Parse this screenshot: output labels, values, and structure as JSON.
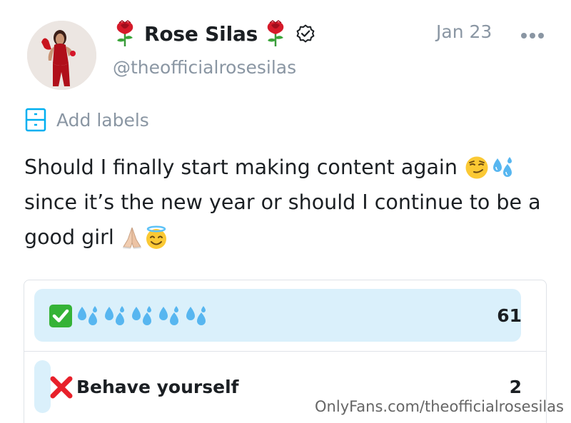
{
  "post": {
    "author": {
      "display_name": "Rose Silas",
      "handle": "@theofficialrosesilas",
      "name_emoji": "rose-icon",
      "verified_icon": "verified-badge-icon"
    },
    "date": "Jan 23",
    "more_icon": "more-dots-icon",
    "labels": {
      "icon": "labels-icon",
      "text": "Add labels"
    },
    "text_lines": [
      "Should I finally start making content again",
      "since it’s the new year or should I continue to be a",
      "good girl"
    ],
    "line_emojis": [
      [
        "smirking-face-icon",
        "sweat-droplets-icon"
      ],
      [],
      [
        "folded-hands-icon",
        "smiling-face-with-halo-icon"
      ]
    ]
  },
  "poll": {
    "options": [
      {
        "label": "",
        "icons": [
          "check-mark-button-icon",
          "sweat-droplets-icon",
          "sweat-droplets-icon",
          "sweat-droplets-icon",
          "sweat-droplets-icon",
          "sweat-droplets-icon"
        ],
        "count": "61",
        "share": 0.968
      },
      {
        "label": "Behave yourself",
        "icons": [
          "cross-mark-icon"
        ],
        "count": "2",
        "share": 0.032
      }
    ]
  },
  "watermark": "OnlyFans.com/theofficialrosesilas",
  "colors": {
    "muted_text": "#8a96a3",
    "accent": "#00aff0",
    "poll_fill": "#daf0fb",
    "border": "#dfe3e8"
  }
}
